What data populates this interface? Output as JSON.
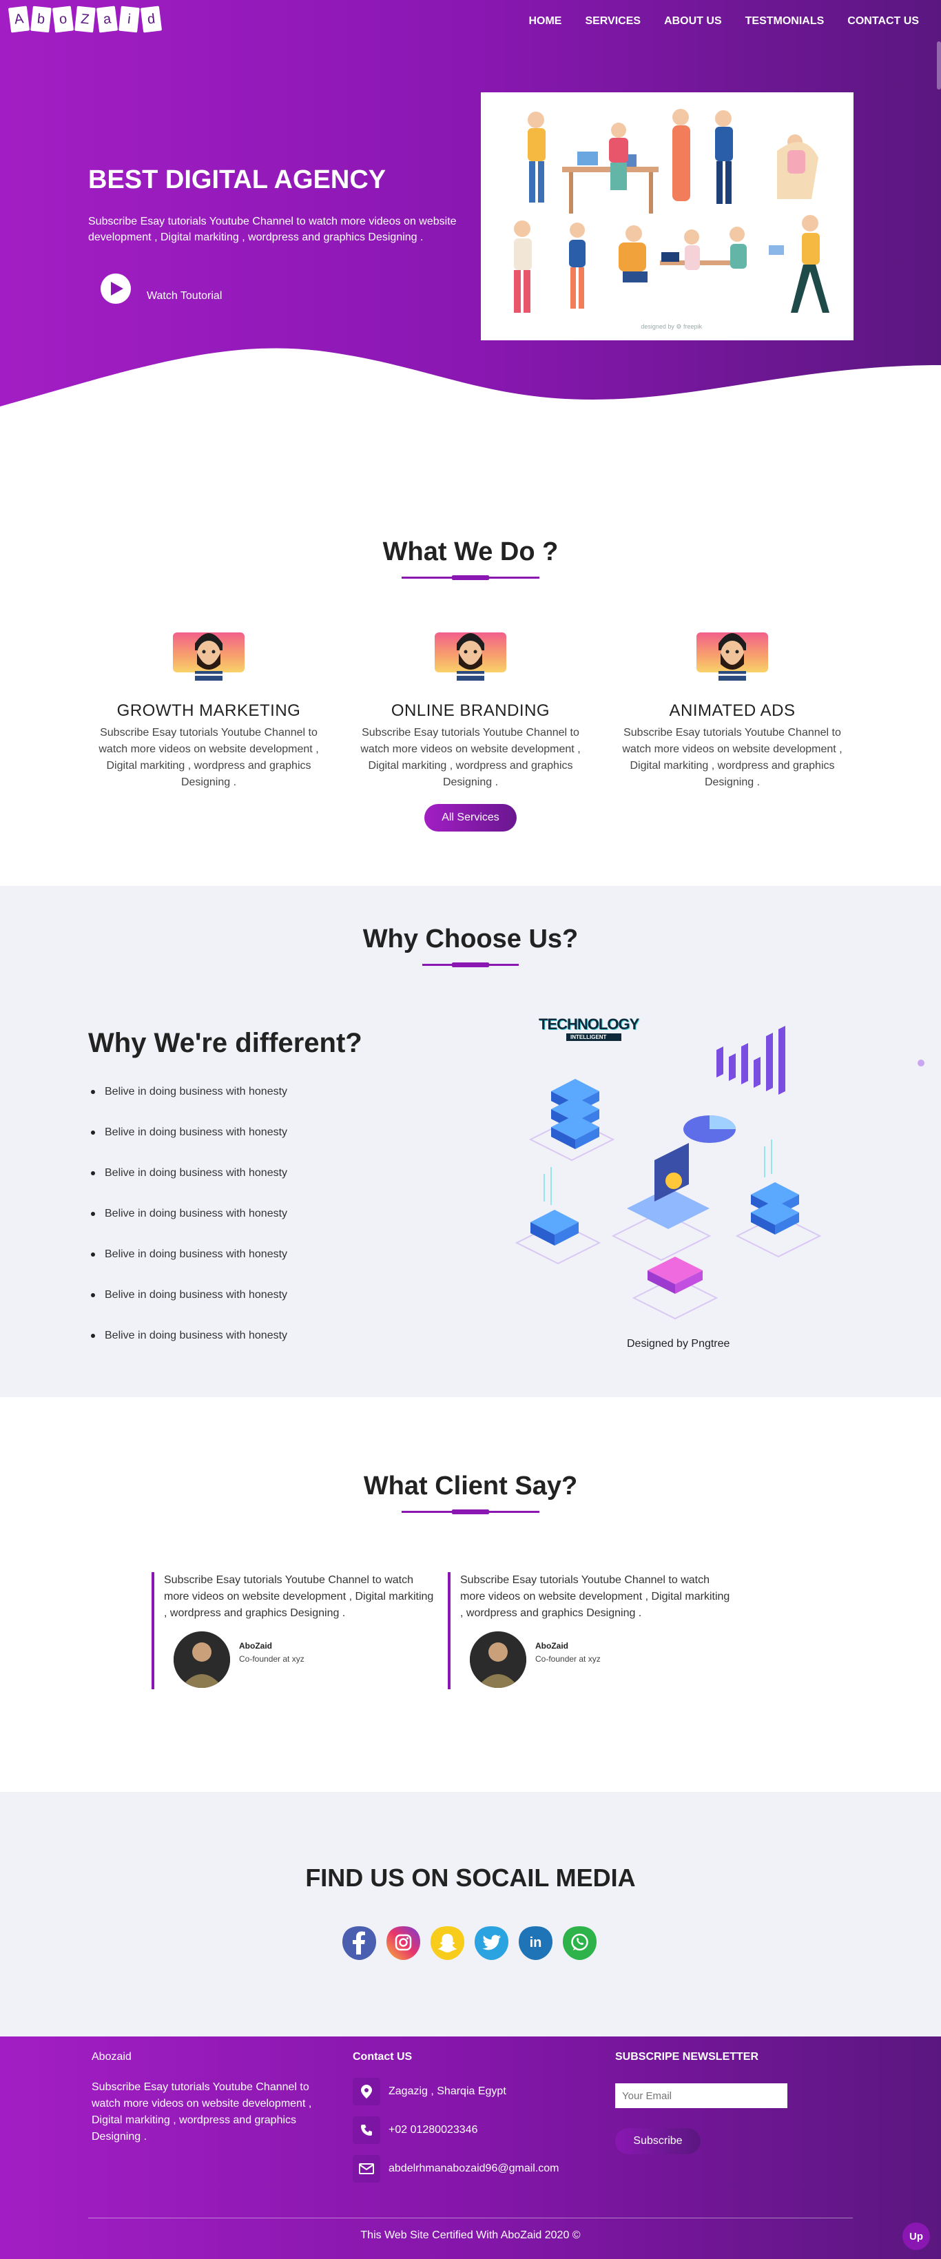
{
  "brand": {
    "logo_letters": [
      "A",
      "b",
      "o",
      "Z",
      "a",
      "i",
      "d"
    ]
  },
  "nav": {
    "items": [
      "HOME",
      "SERVICES",
      "ABOUT US",
      "TESTMONIALS",
      "CONTACT US"
    ]
  },
  "hero": {
    "title": "BEST DIGITAL AGENCY",
    "text": "Subscribe Esay tutorials Youtube Channel to watch more videos on website development , Digital markiting , wordpress and graphics Designing .",
    "watch_label": "Watch Toutorial",
    "image_credit": "designed by ⚙ freepik"
  },
  "what_we_do": {
    "title": "What We Do ?",
    "services": [
      {
        "name": "GROWTH MARKETING",
        "text": "Subscribe Esay tutorials Youtube Channel to watch more videos on website development , Digital markiting , wordpress and graphics Designing ."
      },
      {
        "name": "ONLINE BRANDING",
        "text": "Subscribe Esay tutorials Youtube Channel to watch more videos on website development , Digital markiting , wordpress and graphics Designing ."
      },
      {
        "name": "ANIMATED ADS",
        "text": "Subscribe Esay tutorials Youtube Channel to watch more videos on website development , Digital markiting , wordpress and graphics Designing ."
      }
    ],
    "button": "All Services"
  },
  "why_choose": {
    "title": "Why Choose Us?",
    "subtitle": "Why We're different?",
    "bullets": [
      "Belive in doing business with honesty",
      "Belive in doing business with honesty",
      "Belive in doing business with honesty",
      "Belive in doing business with honesty",
      "Belive in doing business with honesty",
      "Belive in doing business with honesty",
      "Belive in doing business with honesty"
    ],
    "image_logo_title": "TECHNOLOGY",
    "image_logo_sub": "INTELLIGENT",
    "image_credit": "Designed by Pngtree"
  },
  "clients": {
    "title": "What Client Say?",
    "testimonials": [
      {
        "text": "Subscribe Esay tutorials Youtube Channel to watch more videos on website development , Digital markiting , wordpress and graphics Designing .",
        "name": "AboZaid",
        "role": "Co-founder at xyz"
      },
      {
        "text": "Subscribe Esay tutorials Youtube Channel to watch more videos on website development , Digital markiting , wordpress and graphics Designing .",
        "name": "AboZaid",
        "role": "Co-founder at xyz"
      }
    ]
  },
  "social": {
    "title": "FIND US ON SOCAIL MEDIA",
    "icons": [
      "facebook-icon",
      "instagram-icon",
      "snapchat-icon",
      "twitter-icon",
      "linkedin-icon",
      "whatsapp-icon"
    ]
  },
  "footer": {
    "about_title": "Abozaid",
    "about_text": "Subscribe Esay tutorials Youtube Channel to watch more videos on website development , Digital markiting , wordpress and graphics Designing .",
    "contact_title": "Contact US",
    "address": "Zagazig , Sharqia Egypt",
    "phone": "+02 01280023346",
    "email": "abdelrhmanabozaid96@gmail.com",
    "newsletter_title": "SUBSCRIPE NEWSLETTER",
    "email_placeholder": "Your Email",
    "subscribe_label": "Subscribe",
    "copyright": "This Web Site Certified With AboZaid 2020 ©",
    "up_label": "Up"
  },
  "colors": {
    "accent": "#8a17b2",
    "accent_light": "#a21ec4",
    "accent_dark": "#5b1780",
    "section_bg": "#f1f2f8"
  }
}
